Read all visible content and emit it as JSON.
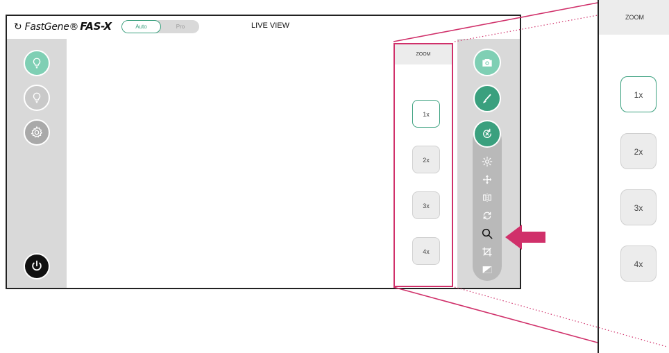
{
  "app": {
    "logo_brand": "FastGene®",
    "logo_model": "FAS-X",
    "title": "LIVE VIEW"
  },
  "mode": {
    "options": [
      "Auto",
      "Pro"
    ],
    "selected": "Auto"
  },
  "left_sidebar": {
    "buttons": [
      "light-on-icon",
      "light-off-icon",
      "settings-icon",
      "power-icon"
    ]
  },
  "zoom_panel": {
    "header": "ZOOM",
    "levels": [
      "1x",
      "2x",
      "3x",
      "4x"
    ],
    "selected": "1x"
  },
  "right_toolbar": {
    "buttons": [
      "camera-icon",
      "brush-icon",
      "reset-icon"
    ],
    "tools": [
      "brightness-icon",
      "move-icon",
      "flip-icon",
      "rotate-icon",
      "zoom-icon",
      "crop-icon",
      "contrast-icon"
    ]
  },
  "colors": {
    "accent": "#3aa07e",
    "highlight": "#d0306a"
  }
}
